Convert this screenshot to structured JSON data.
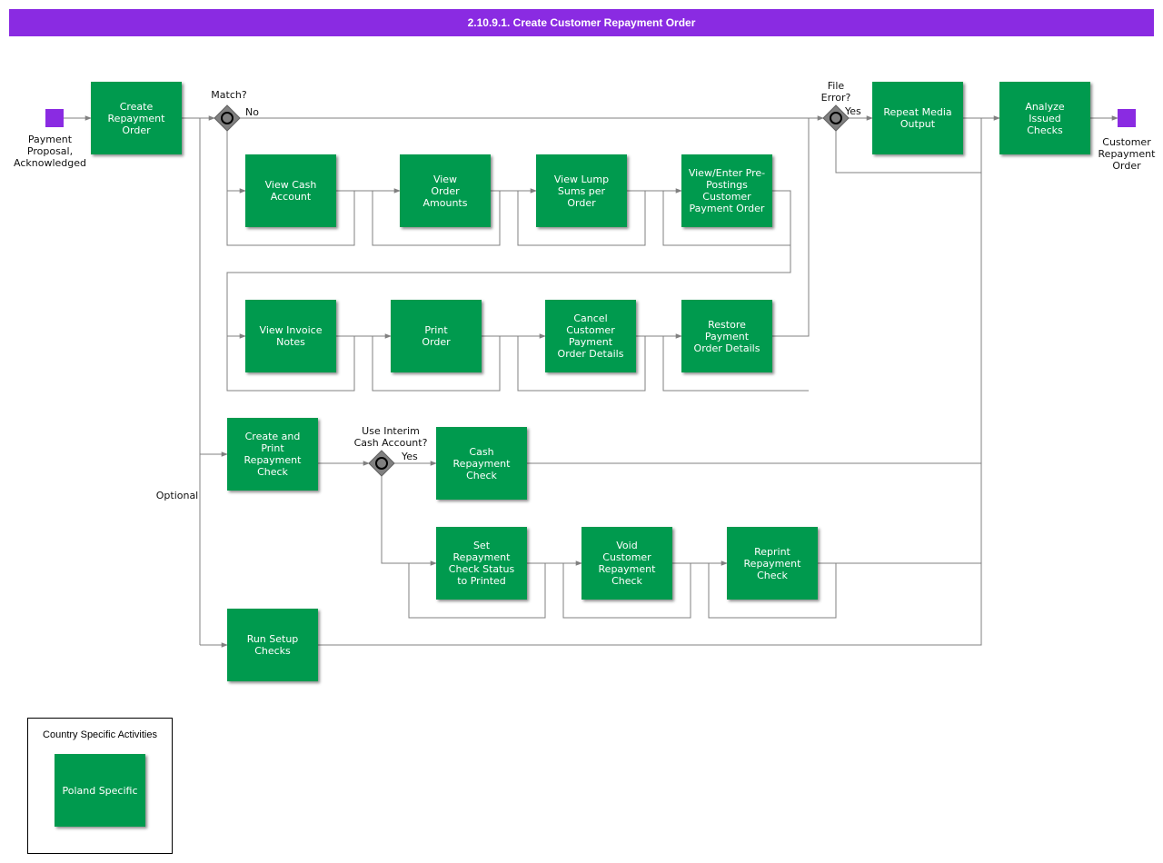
{
  "title": "2.10.9.1. Create Customer Repayment Order",
  "start_label": "Payment\nProposal,\nAcknowledged",
  "end_label": "Customer\nRepayment\nOrder",
  "boxes": {
    "create_repayment_order": "Create\nRepayment\nOrder",
    "view_cash_account": "View Cash\nAccount",
    "view_order_amounts": "View\nOrder\nAmounts",
    "view_lump_sums": "View Lump\nSums per\nOrder",
    "view_enter_prepostings": "View/Enter Pre-\nPostings\nCustomer\nPayment Order",
    "view_invoice_notes": "View Invoice\nNotes",
    "print_order": "Print\nOrder",
    "cancel_payment_order_details": "Cancel\nCustomer\nPayment\nOrder Details",
    "restore_payment_order_details": "Restore\nPayment\nOrder Details",
    "repeat_media_output": "Repeat Media\nOutput",
    "analyze_issued_checks": "Analyze\nIssued\nChecks",
    "create_print_repayment_check": "Create and\nPrint\nRepayment\nCheck",
    "cash_repayment_check": "Cash\nRepayment\nCheck",
    "set_check_status_printed": "Set\nRepayment\nCheck Status\nto Printed",
    "void_customer_repayment_check": "Void\nCustomer\nRepayment\nCheck",
    "reprint_repayment_check": "Reprint\nRepayment\nCheck",
    "run_setup_checks": "Run Setup\nChecks",
    "poland_specific": "Poland Specific"
  },
  "labels": {
    "match": "Match?",
    "no": "No",
    "file_error": "File\nError?",
    "yes_file": "Yes",
    "use_interim": "Use Interim\nCash Account?",
    "yes_interim": "Yes",
    "optional": "Optional"
  },
  "legend": {
    "title": "Country Specific Activities"
  },
  "colors": {
    "title_bar": "#8a2be2",
    "activity": "#009a4e",
    "terminal": "#8a2be2",
    "gateway": "#808080",
    "connector": "#808080"
  }
}
